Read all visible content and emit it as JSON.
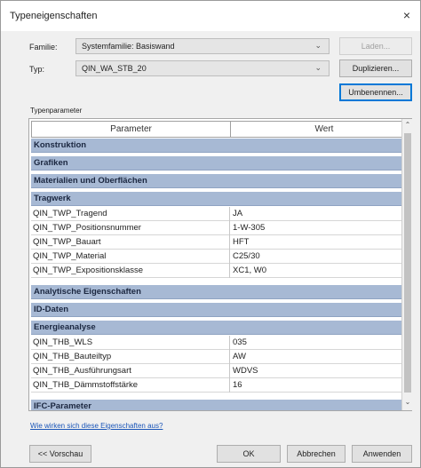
{
  "window": {
    "title": "Typeneigenschaften",
    "close_glyph": "×"
  },
  "familie": {
    "label": "Familie:",
    "value": "Systemfamilie: Basiswand",
    "load_button": "Laden..."
  },
  "typ": {
    "label": "Typ:",
    "value": "QIN_WA_STB_20",
    "duplicate_button": "Duplizieren...",
    "rename_button": "Umbenennen..."
  },
  "typenparameter_label": "Typenparameter",
  "grid": {
    "col_param": "Parameter",
    "col_value": "Wert",
    "col_eq": "=",
    "rows": [
      {
        "kind": "group",
        "label": "Konstruktion",
        "expanded": false
      },
      {
        "kind": "group",
        "label": "Grafiken",
        "expanded": false
      },
      {
        "kind": "group",
        "label": "Materialien und Oberflächen",
        "expanded": false
      },
      {
        "kind": "group",
        "label": "Tragwerk",
        "expanded": true
      },
      {
        "kind": "param",
        "label": "QIN_TWP_Tragend",
        "value": "JA"
      },
      {
        "kind": "param",
        "label": "QIN_TWP_Positionsnummer",
        "value": "1-W-305"
      },
      {
        "kind": "param",
        "label": "QIN_TWP_Bauart",
        "value": "HFT"
      },
      {
        "kind": "param",
        "label": "QIN_TWP_Material",
        "value": "C25/30"
      },
      {
        "kind": "param",
        "label": "QIN_TWP_Expositionsklasse",
        "value": "XC1, W0"
      },
      {
        "kind": "group",
        "label": "Analytische Eigenschaften",
        "expanded": false
      },
      {
        "kind": "group",
        "label": "ID-Daten",
        "expanded": false
      },
      {
        "kind": "group",
        "label": "Energieanalyse",
        "expanded": true
      },
      {
        "kind": "param",
        "label": "QIN_THB_WLS",
        "value": "035"
      },
      {
        "kind": "param",
        "label": "QIN_THB_Bauteiltyp",
        "value": "AW"
      },
      {
        "kind": "param",
        "label": "QIN_THB_Ausführungsart",
        "value": "WDVS"
      },
      {
        "kind": "param",
        "label": "QIN_THB_Dämmstoffstärke",
        "value": "16"
      },
      {
        "kind": "group",
        "label": "IFC-Parameter",
        "expanded": false
      }
    ]
  },
  "help_link": "Wie wirken sich diese Eigenschaften aus?",
  "footer": {
    "preview_button": "<< Vorschau",
    "ok_button": "OK",
    "cancel_button": "Abbrechen",
    "apply_button": "Anwenden"
  },
  "icons": {
    "close": "close-icon",
    "dropdown": "chevron-down-icon",
    "group_toggle": "chevron-double-icon",
    "scroll_up": "scroll-up-icon",
    "scroll_down": "scroll-down-icon"
  }
}
